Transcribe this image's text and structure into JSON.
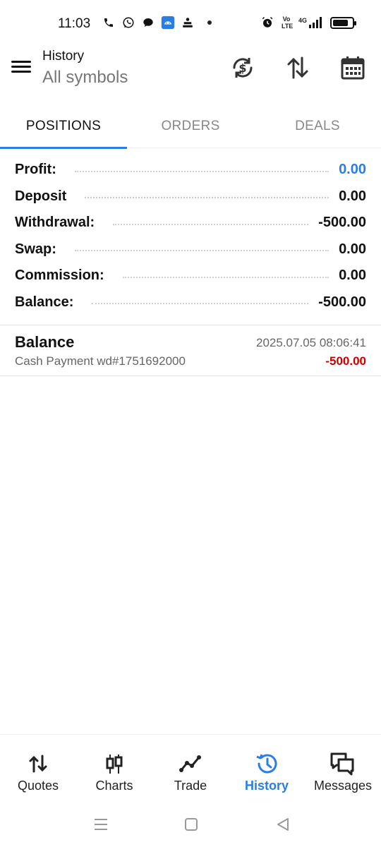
{
  "status_bar": {
    "time": "11:03",
    "network": "4G",
    "volte": "Vo LTE",
    "battery_level": 0.8,
    "icons_left": [
      "phone-icon",
      "whatsapp-icon",
      "chat-icon",
      "app-icon",
      "app2-icon",
      "notification-dot"
    ],
    "icons_right": [
      "alarm-icon",
      "volte-icon",
      "signal-icon",
      "battery-icon"
    ]
  },
  "header": {
    "title": "History",
    "subtitle": "All symbols",
    "actions": [
      "currency-refresh-icon",
      "sort-icon",
      "calendar-icon"
    ]
  },
  "tabs": [
    {
      "label": "POSITIONS",
      "active": true
    },
    {
      "label": "ORDERS",
      "active": false
    },
    {
      "label": "DEALS",
      "active": false
    }
  ],
  "summary": [
    {
      "label": "Profit:",
      "value": "0.00"
    },
    {
      "label": "Deposit",
      "value": "0.00"
    },
    {
      "label": "Withdrawal:",
      "value": "-500.00"
    },
    {
      "label": "Swap:",
      "value": "0.00"
    },
    {
      "label": "Commission:",
      "value": "0.00"
    },
    {
      "label": "Balance:",
      "value": "-500.00"
    }
  ],
  "deal": {
    "title": "Balance",
    "datetime": "2025.07.05 08:06:41",
    "comment": "Cash Payment wd#1751692000",
    "amount": "-500.00"
  },
  "bottom_nav": [
    {
      "label": "Quotes",
      "icon": "quotes-arrows-icon",
      "active": false
    },
    {
      "label": "Charts",
      "icon": "candlestick-icon",
      "active": false
    },
    {
      "label": "Trade",
      "icon": "trade-line-icon",
      "active": false
    },
    {
      "label": "History",
      "icon": "history-clock-icon",
      "active": true
    },
    {
      "label": "Messages",
      "icon": "messages-icon",
      "active": false
    }
  ],
  "colors": {
    "accent": "#2a7ee3",
    "negative": "#c80000",
    "text": "#111111",
    "muted": "#777777"
  }
}
